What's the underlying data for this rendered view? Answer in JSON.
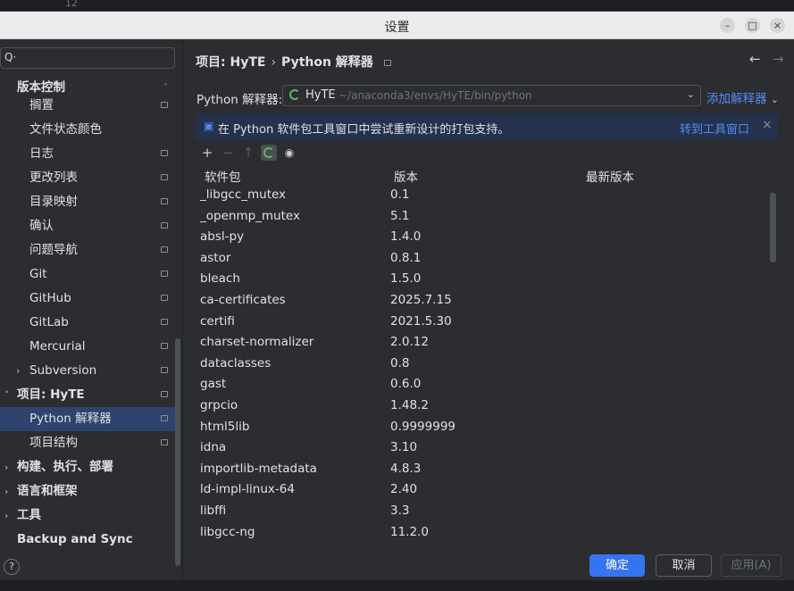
{
  "background": {
    "line_number": "12"
  },
  "window": {
    "title": "设置",
    "min_label": "–",
    "max_label": "□",
    "close_label": "×"
  },
  "sidebar": {
    "search_placeholder": "",
    "search_icon": "Q·",
    "items": [
      {
        "label": "版本控制",
        "bold": true
      },
      {
        "label": "搁置"
      },
      {
        "label": "文件状态颜色"
      },
      {
        "label": "日志"
      },
      {
        "label": "更改列表"
      },
      {
        "label": "目录映射"
      },
      {
        "label": "确认"
      },
      {
        "label": "问题导航"
      },
      {
        "label": "Git"
      },
      {
        "label": "GitHub"
      },
      {
        "label": "GitLab"
      },
      {
        "label": "Mercurial"
      },
      {
        "label": "Subversion"
      },
      {
        "label": "项目: HyTE",
        "bold": true
      },
      {
        "label": "Python 解释器",
        "selected": true
      },
      {
        "label": "项目结构"
      },
      {
        "label": "构建、执行、部署",
        "bold": true
      },
      {
        "label": "语言和框架",
        "bold": true
      },
      {
        "label": "工具",
        "bold": true
      },
      {
        "label": "Backup and Sync",
        "bold": true
      }
    ],
    "help_label": "?"
  },
  "main": {
    "breadcrumb": {
      "project": "项目: HyTE",
      "sep": "›",
      "page": "Python 解释器"
    },
    "nav": {
      "back": "←",
      "forward": "→"
    },
    "interpreter": {
      "label": "Python 解释器:",
      "name": "HyTE",
      "path": "~/anaconda3/envs/HyTE/bin/python",
      "dropdown": "⌄",
      "add_label": "添加解释器",
      "add_chevron": "⌄"
    },
    "banner": {
      "icon": "package-icon",
      "text": "在 Python 软件包工具窗口中尝试重新设计的打包支持。",
      "link": "转到工具窗口",
      "close": "×"
    },
    "toolbar": {
      "add": "+",
      "remove": "−",
      "up": "↑",
      "eye": "◉"
    },
    "table": {
      "headers": [
        "软件包",
        "版本",
        "最新版本"
      ],
      "rows": [
        [
          "_libgcc_mutex",
          "0.1"
        ],
        [
          "_openmp_mutex",
          "5.1"
        ],
        [
          "absl-py",
          "1.4.0"
        ],
        [
          "astor",
          "0.8.1"
        ],
        [
          "bleach",
          "1.5.0"
        ],
        [
          "ca-certificates",
          "2025.7.15"
        ],
        [
          "certifi",
          "2021.5.30"
        ],
        [
          "charset-normalizer",
          "2.0.12"
        ],
        [
          "dataclasses",
          "0.8"
        ],
        [
          "gast",
          "0.6.0"
        ],
        [
          "grpcio",
          "1.48.2"
        ],
        [
          "html5lib",
          "0.9999999"
        ],
        [
          "idna",
          "3.10"
        ],
        [
          "importlib-metadata",
          "4.8.3"
        ],
        [
          "ld-impl-linux-64",
          "2.40"
        ],
        [
          "libffi",
          "3.3"
        ],
        [
          "libgcc-ng",
          "11.2.0"
        ]
      ]
    },
    "buttons": {
      "ok": "确定",
      "cancel": "取消",
      "apply": "应用(A)"
    }
  }
}
